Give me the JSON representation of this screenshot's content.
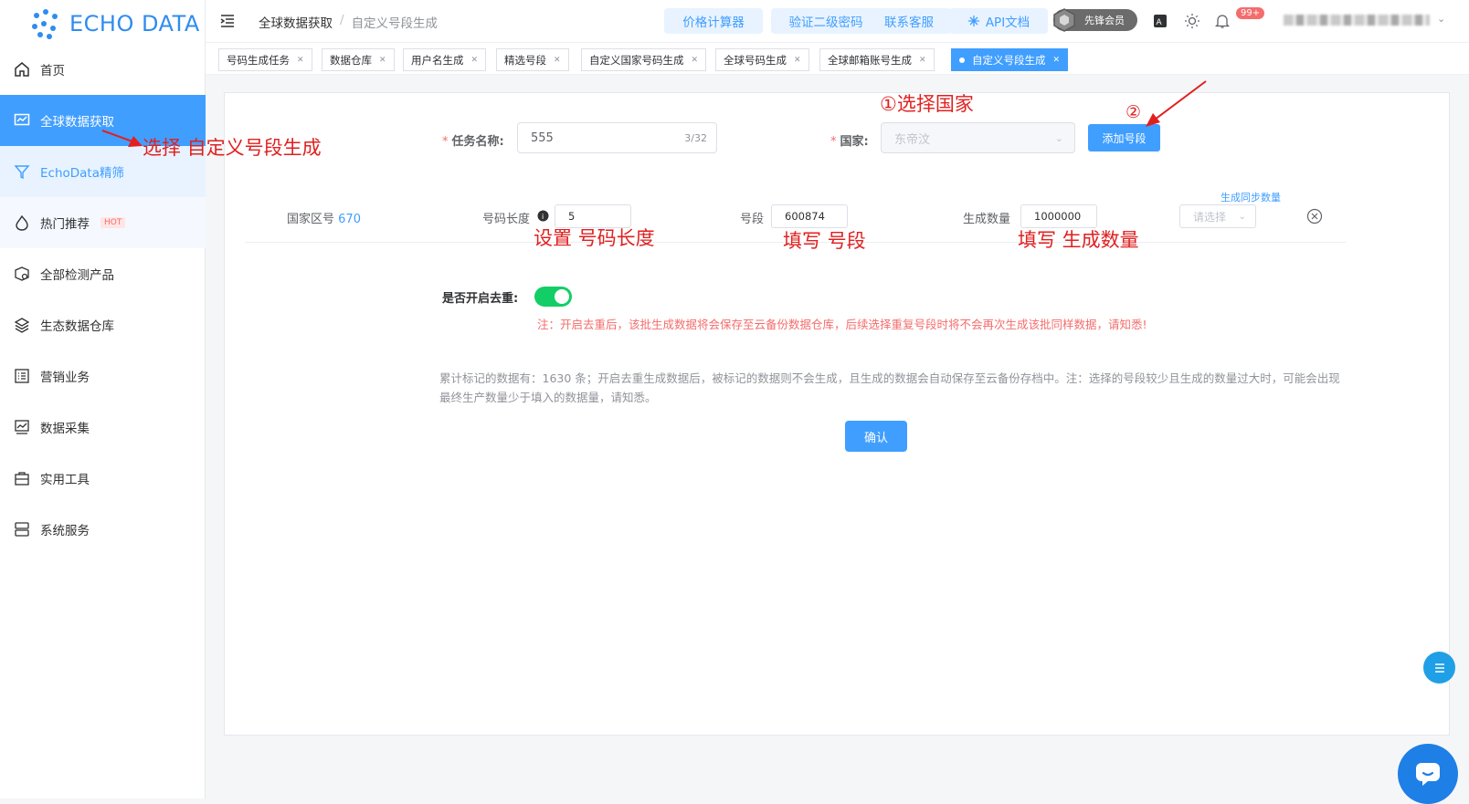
{
  "app": {
    "logo_text": "ECHO DATA"
  },
  "sidebar": {
    "items": [
      {
        "label": "首页",
        "icon": "home-icon"
      },
      {
        "label": "全球数据获取",
        "icon": "monitor-chart-icon"
      },
      {
        "label": "EchoData精筛",
        "icon": "filter-icon"
      },
      {
        "label": "热门推荐",
        "icon": "flame-icon",
        "badge": "HOT"
      },
      {
        "label": "全部检测产品",
        "icon": "box-search-icon"
      },
      {
        "label": "生态数据仓库",
        "icon": "layers-icon"
      },
      {
        "label": "营销业务",
        "icon": "list-icon"
      },
      {
        "label": "数据采集",
        "icon": "chart-icon"
      },
      {
        "label": "实用工具",
        "icon": "briefcase-icon"
      },
      {
        "label": "系统服务",
        "icon": "server-icon"
      }
    ]
  },
  "header": {
    "breadcrumb": [
      "全球数据获取",
      "/",
      "自定义号段生成"
    ],
    "buttons": [
      "价格计算器",
      "验证二级密码",
      "联系客服",
      "API文档"
    ],
    "vip_label": "先锋会员",
    "notification_badge": "99+"
  },
  "tabs": [
    {
      "label": "号码生成任务"
    },
    {
      "label": "数据仓库"
    },
    {
      "label": "用户名生成"
    },
    {
      "label": "精选号段"
    },
    {
      "label": "自定义国家号码生成"
    },
    {
      "label": "全球号码生成"
    },
    {
      "label": "全球邮箱账号生成"
    },
    {
      "label": "自定义号段生成",
      "active": true
    }
  ],
  "form": {
    "task_name_label": "任务名称:",
    "task_name_value": "555",
    "task_name_counter": "3/32",
    "country_label": "国家:",
    "country_value": "东帝汶",
    "add_segment_button": "添加号段",
    "row": {
      "country_code_label": "国家区号",
      "country_code_value": "670",
      "length_label": "号码长度",
      "length_value": "5",
      "segment_label": "号段",
      "segment_value": "600874",
      "quantity_label": "生成数量",
      "quantity_value": "1000000",
      "sync_link": "生成同步数量",
      "select_placeholder": "请选择"
    },
    "dedupe_label": "是否开启去重:",
    "dedupe_enabled": true,
    "dedupe_note": "注：开启去重后，该批生成数据将会保存至云备份数据仓库，后续选择重复号段时将不会再次生成该批同样数据，请知悉!",
    "info_note": "累计标记的数据有：1630 条；开启去重生成数据后，被标记的数据则不会生成，且生成的数据会自动保存至云备份存档中。注：选择的号段较少且生成的数量过大时，可能会出现最终生产数量少于填入的数据量，请知悉。",
    "confirm_button": "确认"
  },
  "annotations": {
    "step1": "①选择国家",
    "step2": "②",
    "select_menu": "选择 自定义号段生成",
    "set_length": "设置 号码长度",
    "fill_segment": "填写 号段",
    "fill_quantity": "填写 生成数量"
  },
  "colors": {
    "primary": "#409eff",
    "annotation": "#e02020",
    "switch_on": "#13ce66",
    "warning_text": "#f56c6c"
  }
}
